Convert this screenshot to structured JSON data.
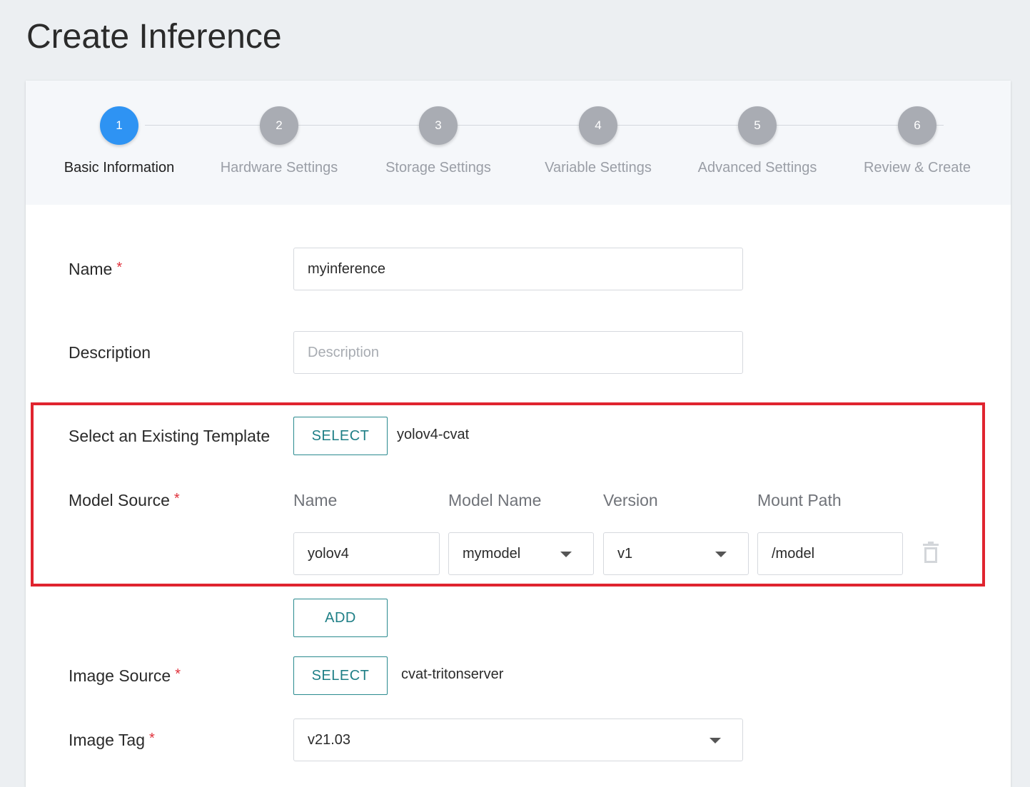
{
  "page": {
    "title": "Create Inference"
  },
  "stepper": {
    "steps": [
      {
        "number": "1",
        "label": "Basic Information"
      },
      {
        "number": "2",
        "label": "Hardware Settings"
      },
      {
        "number": "3",
        "label": "Storage Settings"
      },
      {
        "number": "4",
        "label": "Variable Settings"
      },
      {
        "number": "5",
        "label": "Advanced Settings"
      },
      {
        "number": "6",
        "label": "Review & Create"
      }
    ],
    "active_step": 1
  },
  "form": {
    "name": {
      "label": "Name",
      "required_mark": "*",
      "value": "myinference"
    },
    "description": {
      "label": "Description",
      "placeholder": "Description",
      "value": ""
    },
    "template": {
      "label": "Select an Existing Template",
      "button": "SELECT",
      "selected": "yolov4-cvat"
    },
    "model_source": {
      "label": "Model Source",
      "required_mark": "*",
      "columns": [
        "Name",
        "Model Name",
        "Version",
        "Mount Path"
      ],
      "rows": [
        {
          "name": "yolov4",
          "model_name": "mymodel",
          "version": "v1",
          "mount_path": "/model"
        }
      ],
      "add_button": "ADD"
    },
    "image_source": {
      "label": "Image Source",
      "required_mark": "*",
      "button": "SELECT",
      "selected": "cvat-tritonserver"
    },
    "image_tag": {
      "label": "Image Tag",
      "required_mark": "*",
      "value": "v21.03"
    }
  },
  "colors": {
    "accent": "#2e93f3",
    "button_text": "#1e7f86",
    "required": "#e0313b",
    "highlight": "#e0242f",
    "step_inactive": "#a9acb3"
  },
  "icons": {
    "delete_row": "trash-icon",
    "dropdown": "caret-down-icon"
  }
}
